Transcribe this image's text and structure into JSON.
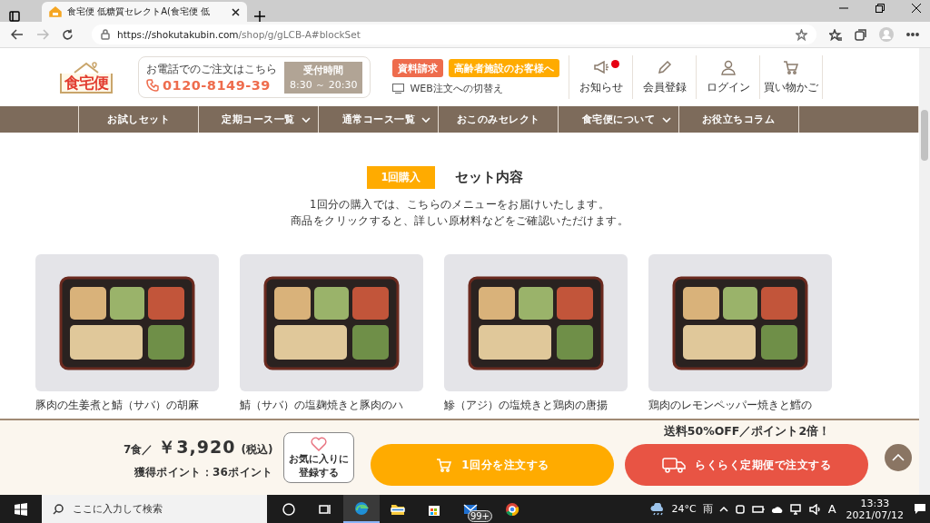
{
  "browser": {
    "tab_title": "食宅便 低糖質セレクトA(食宅便 低",
    "url_host": "https://shokutakubin.com",
    "url_path": "/shop/g/gLCB-A#blockSet"
  },
  "header": {
    "logo_text": "食宅便",
    "phone_caption": "お電話でのご注文はこちら",
    "phone_number": "0120-8149-39",
    "hours_label": "受付時間",
    "hours_time": "8:30 ～ 20:30",
    "buttons": [
      {
        "label": "資料請求",
        "color": "#ee6c4d"
      },
      {
        "label": "高齢者施設のお客様へ",
        "color": "#ffab00"
      }
    ],
    "web_switch": "WEB注文への切替え",
    "icons": [
      {
        "label": "お知らせ",
        "kind": "megaphone",
        "notification": true
      },
      {
        "label": "会員登録",
        "kind": "pencil",
        "notification": false
      },
      {
        "label": "ログイン",
        "kind": "person",
        "notification": false
      },
      {
        "label": "買い物かご",
        "kind": "cart",
        "notification": false
      }
    ]
  },
  "nav": {
    "items": [
      {
        "label": "お試しセット",
        "dropdown": false
      },
      {
        "label": "定期コース一覧",
        "dropdown": true
      },
      {
        "label": "通常コース一覧",
        "dropdown": true
      },
      {
        "label": "おこのみセレクト",
        "dropdown": false
      },
      {
        "label": "食宅便について",
        "dropdown": true
      },
      {
        "label": "お役立ちコラム",
        "dropdown": false
      }
    ]
  },
  "section": {
    "badge": "1回購入",
    "title": "セット内容",
    "lines": [
      "1回分の購入では、こちらのメニューをお届けいたします。",
      "商品をクリックすると、詳しい原材料などをご確認いただけます。"
    ]
  },
  "products": [
    {
      "name": "豚肉の生姜煮と鯖（サバ）の胡麻"
    },
    {
      "name": "鯖（サバ）の塩麹焼きと豚肉のハ"
    },
    {
      "name": "鰺（アジ）の塩焼きと鶏肉の唐揚"
    },
    {
      "name": "鶏肉のレモンペッパー焼きと鱈の"
    }
  ],
  "order_bar": {
    "count": "7食／",
    "price": "￥3,920",
    "tax": "(税込)",
    "points": "獲得ポイント：36ポイント",
    "favorite": [
      "お気に入りに",
      "登録する"
    ],
    "promo": "送料50%OFF／ポイント2倍！",
    "single_button": "1回分を注文する",
    "subscription_button": "らくらく定期便で注文する"
  },
  "taskbar": {
    "search_placeholder": "ここに入力して検索",
    "mail_badge": "99+",
    "weather": "24°C",
    "weather_text": "雨",
    "ime": "A",
    "time": "13:33",
    "date": "2021/07/12"
  }
}
